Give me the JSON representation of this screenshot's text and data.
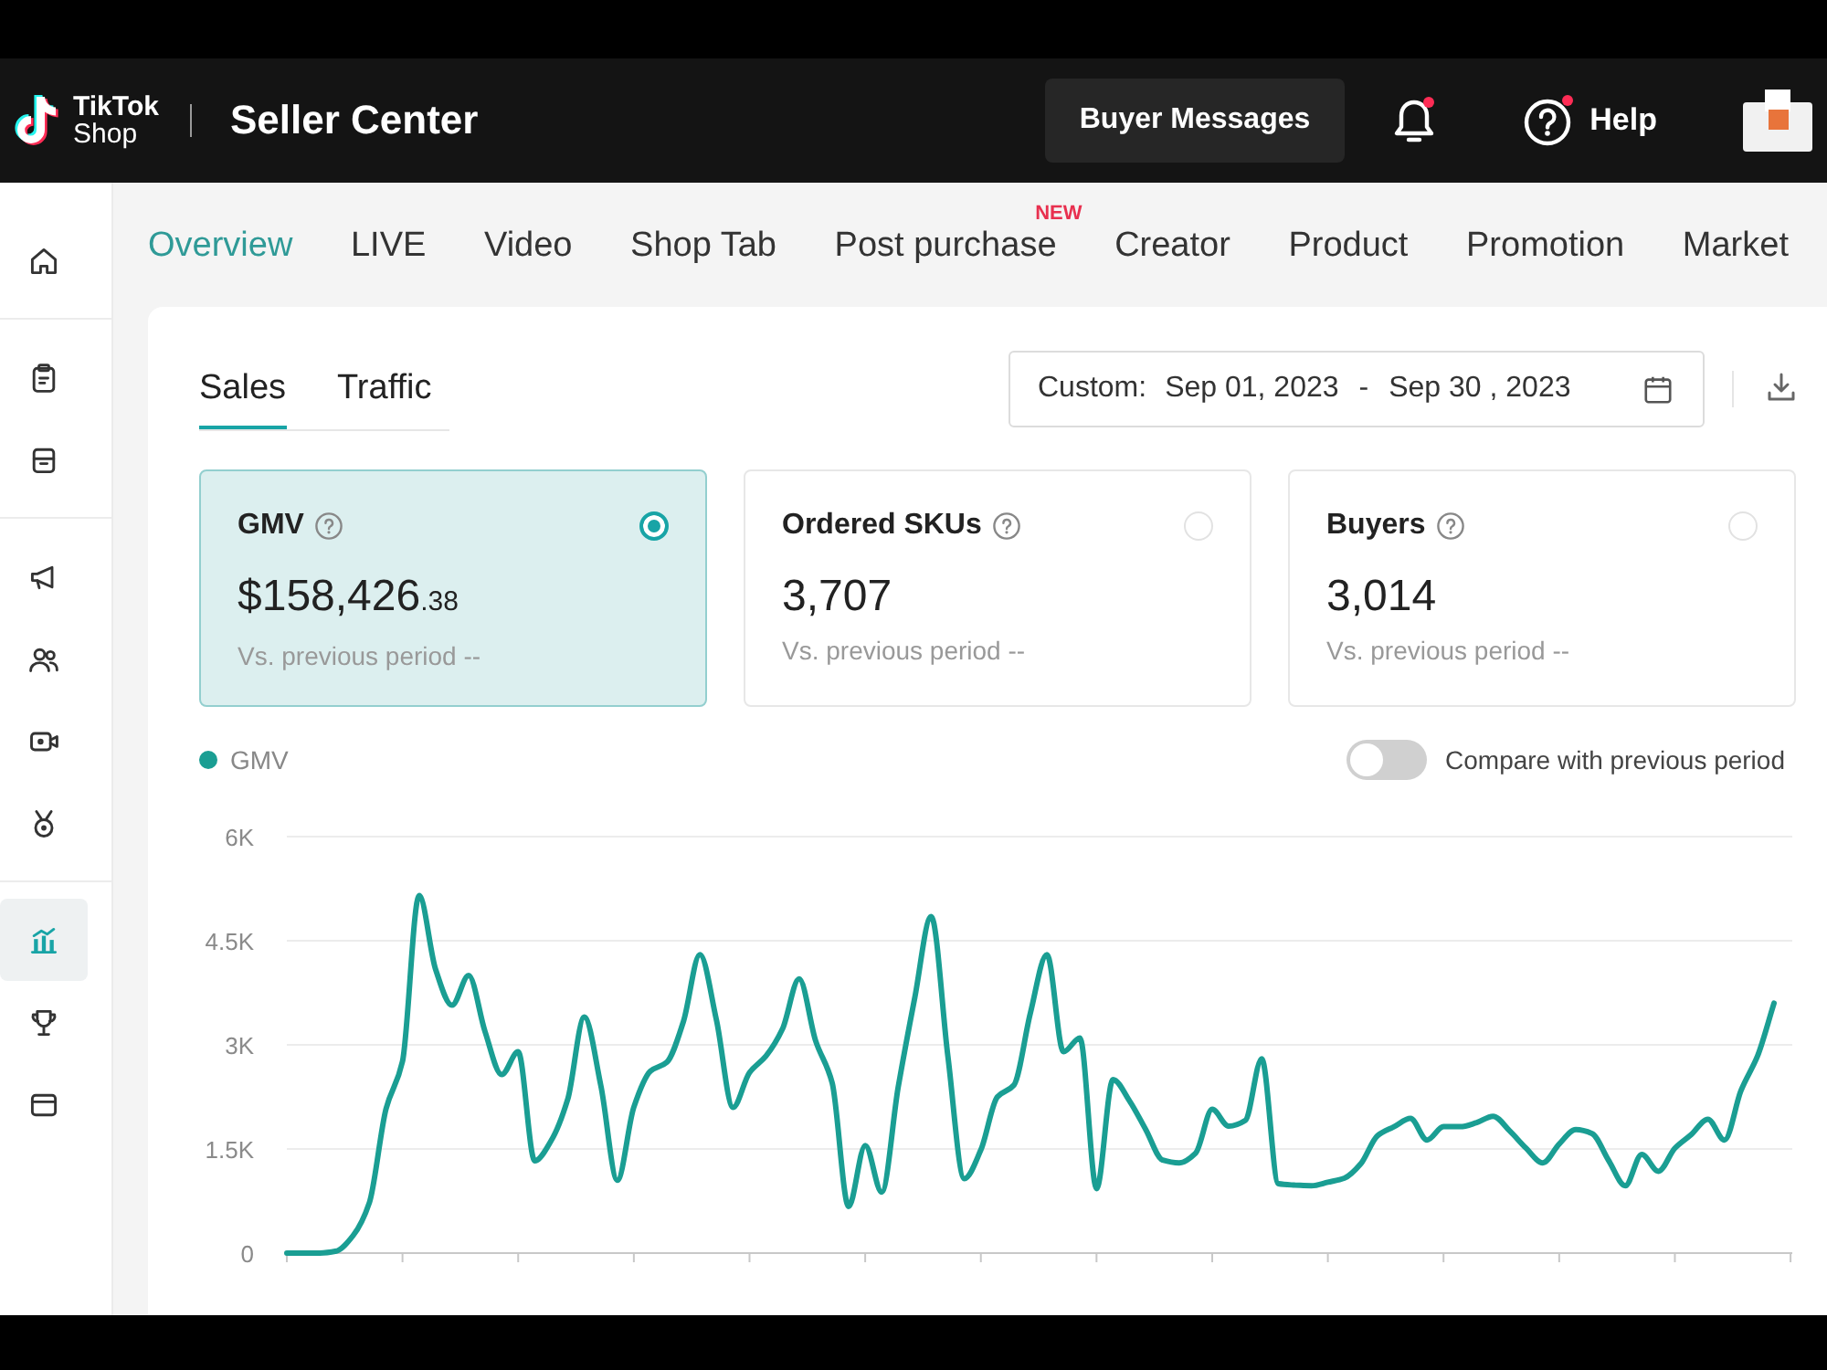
{
  "header": {
    "logo_title": "TikTok",
    "logo_subtitle": "Shop",
    "title": "Seller Center",
    "buyer_messages": "Buyer Messages",
    "bell": {
      "dot": true
    },
    "help": {
      "label": "Help",
      "dot": true
    }
  },
  "sidebar": {
    "groups": [
      {
        "items": [
          {
            "kind": "home",
            "selected": false
          }
        ]
      },
      {
        "items": [
          {
            "kind": "clipboard",
            "selected": false
          },
          {
            "kind": "box",
            "selected": false
          }
        ]
      },
      {
        "items": [
          {
            "kind": "megaphone",
            "selected": false
          },
          {
            "kind": "people",
            "selected": false
          },
          {
            "kind": "video",
            "selected": false
          },
          {
            "kind": "medal",
            "selected": false
          }
        ]
      },
      {
        "items": [
          {
            "kind": "chart",
            "selected": true
          },
          {
            "kind": "trophy",
            "selected": false
          },
          {
            "kind": "card",
            "selected": false
          }
        ]
      }
    ]
  },
  "nav_tabs": [
    {
      "label": "Overview",
      "selected": true
    },
    {
      "label": "LIVE",
      "selected": false
    },
    {
      "label": "Video",
      "selected": false
    },
    {
      "label": "Shop Tab",
      "selected": false
    },
    {
      "label": "Post purchase",
      "selected": false,
      "badge": "NEW"
    },
    {
      "label": "Creator",
      "selected": false
    },
    {
      "label": "Product",
      "selected": false
    },
    {
      "label": "Promotion",
      "selected": false
    },
    {
      "label": "Market",
      "selected": false
    }
  ],
  "report": {
    "tabs": [
      {
        "label": "Sales",
        "selected": true
      },
      {
        "label": "Traffic",
        "selected": false
      }
    ],
    "date_range": {
      "prefix": "Custom:",
      "start": "Sep 01, 2023",
      "separator": "-",
      "end": "Sep 30 , 2023"
    },
    "metrics": [
      {
        "title": "GMV",
        "value": "$158,426",
        "value_fraction": ".38",
        "comparison": "Vs. previous period --",
        "selected": true
      },
      {
        "title": "Ordered SKUs",
        "value": "3,707",
        "comparison": "Vs. previous period --",
        "selected": false
      },
      {
        "title": "Buyers",
        "value": "3,014",
        "comparison": "Vs. previous period --",
        "selected": false
      }
    ],
    "compare_toggle": {
      "label": "Compare with previous period",
      "on": false
    },
    "chart_data": {
      "type": "line",
      "grid": true,
      "categories": [
        null,
        null,
        null,
        null,
        null,
        null,
        null,
        null,
        null,
        null,
        null,
        null,
        null,
        null,
        null,
        null,
        null,
        null,
        null,
        null,
        null,
        null,
        null,
        null,
        null,
        null,
        null,
        null,
        null,
        null,
        null,
        null,
        null,
        null,
        null,
        null,
        null,
        null,
        null,
        null,
        null,
        null,
        null,
        null,
        null,
        null,
        null,
        null,
        null,
        null,
        null,
        null,
        null,
        null,
        null,
        null,
        null,
        null,
        null,
        null,
        null,
        null,
        null,
        null,
        null,
        null,
        null,
        null,
        null,
        null,
        null,
        null,
        null,
        null,
        null,
        null,
        null,
        null,
        null,
        null,
        null,
        null,
        null,
        null,
        null,
        null,
        null,
        null,
        null,
        null,
        null
      ],
      "series": [
        {
          "name": "GMV",
          "color": "#1a9e93",
          "values": [
            0,
            0,
            0,
            30,
            250,
            730,
            2080,
            2760,
            5150,
            4090,
            3570,
            4000,
            3190,
            2570,
            2900,
            1330,
            1620,
            2220,
            3400,
            2420,
            1050,
            2100,
            2620,
            2750,
            3340,
            4300,
            3350,
            2100,
            2600,
            2840,
            3230,
            3950,
            3060,
            2450,
            670,
            1550,
            880,
            2390,
            3680,
            4850,
            2840,
            1070,
            1490,
            2250,
            2420,
            3460,
            4300,
            2900,
            3100,
            930,
            2500,
            2190,
            1770,
            1340,
            1300,
            1440,
            2070,
            1830,
            1910,
            2800,
            1000,
            980,
            970,
            1020,
            1080,
            1290,
            1690,
            1820,
            1940,
            1630,
            1820,
            1820,
            1880,
            1970,
            1760,
            1510,
            1300,
            1570,
            1780,
            1720,
            1330,
            970,
            1420,
            1180,
            1510,
            1710,
            1930,
            1630,
            2340,
            2840,
            3600
          ]
        }
      ],
      "ylim": [
        0,
        6000
      ],
      "yticks": [
        {
          "value": 0,
          "label": "0"
        },
        {
          "value": 1500,
          "label": "1.5K"
        },
        {
          "value": 3000,
          "label": "3K"
        },
        {
          "value": 4500,
          "label": "4.5K"
        },
        {
          "value": 6000,
          "label": "6K"
        }
      ]
    }
  }
}
